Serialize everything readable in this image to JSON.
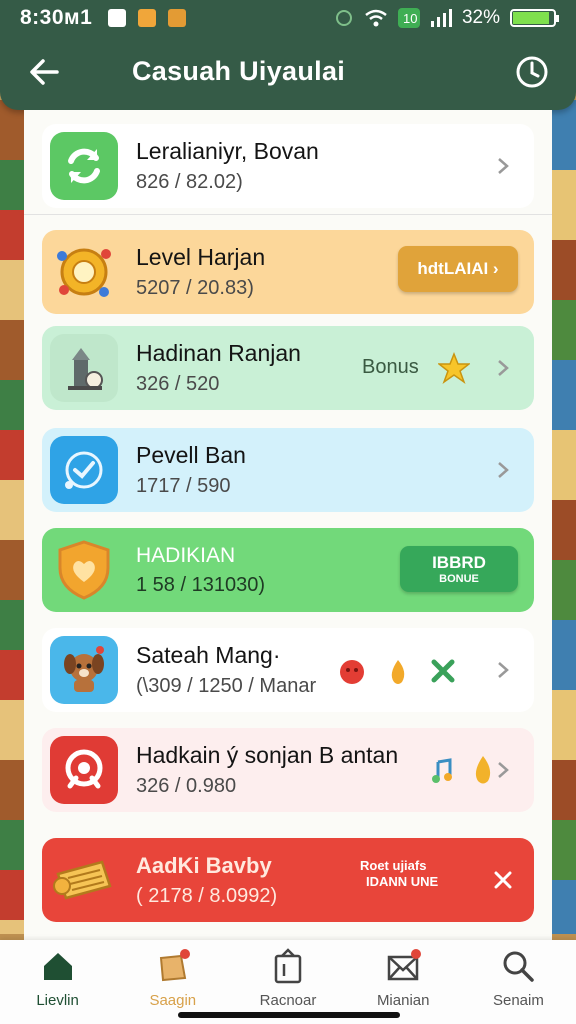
{
  "status": {
    "time": "8:30ᴍ1",
    "battery_text": "32%",
    "battery_level": 0.9
  },
  "header": {
    "title": "Casuah Uiyaulai"
  },
  "colors": {
    "header_bg": "#355b47",
    "accent_orange": "#e0a33a",
    "accent_green": "#36a85a",
    "accent_red": "#e0463a"
  },
  "items": [
    {
      "name": "Leralianiyr, Bovan",
      "score": "826  / 82.02)",
      "icon": "refresh-icon"
    },
    {
      "name": "Level Harjan",
      "score": "5207 / 20.83)",
      "icon": "gear-sun-icon",
      "badge": "hdtLAIAI ›"
    },
    {
      "name": "Hadinan Ranjan",
      "score": "326 / 520",
      "icon": "lantern-icon",
      "bonus": "Bonus"
    },
    {
      "name": "Pevell Ban",
      "score": "1717 / 590",
      "icon": "check-circle-icon"
    },
    {
      "name": "HADIKIAN",
      "score": "1 58 / 131030)",
      "icon": "shield-heart-icon",
      "badge_line1": "IBBRD",
      "badge_line2": "BONUE"
    },
    {
      "name": "Sateah Mang·",
      "score": "(\\309 / 1250 / Manar",
      "icon": "dog-icon"
    },
    {
      "name": "Hadkain ý sonjan B antan",
      "score": "326  / 0.980",
      "icon": "target-icon"
    },
    {
      "name": "AadKi Bavby",
      "score": "( 2178 / 8.0992)",
      "icon": "scroll-icon",
      "badge_line1": "Roet ujiafs",
      "badge_line2": "IDANN UNE"
    }
  ],
  "nav": [
    {
      "label": "Lievlin",
      "icon": "home-icon"
    },
    {
      "label": "Saagin",
      "icon": "shop-bag-icon"
    },
    {
      "label": "Racnoar",
      "icon": "clipboard-icon"
    },
    {
      "label": "Mianian",
      "icon": "mail-icon"
    },
    {
      "label": "Senaim",
      "icon": "search-icon"
    }
  ]
}
